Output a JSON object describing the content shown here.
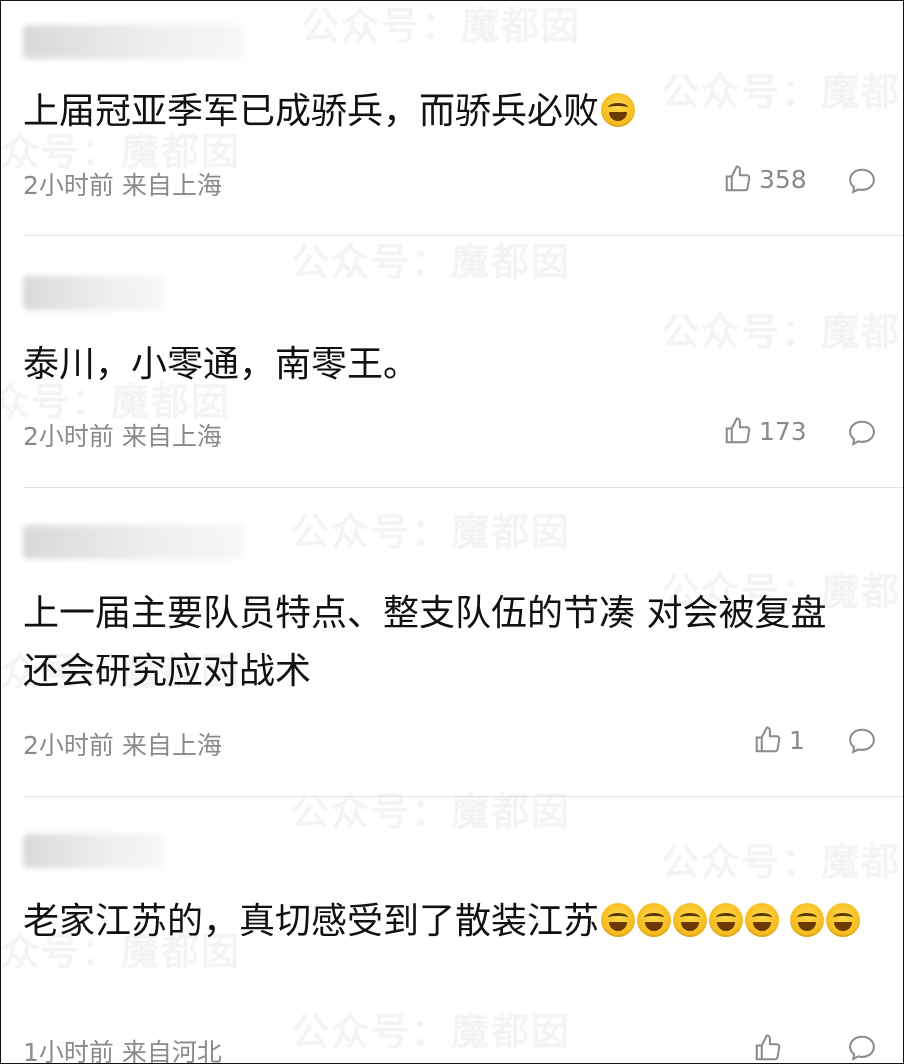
{
  "watermark": "公众号：魔都囡",
  "comments": [
    {
      "text": "上届冠亚季军已成骄兵，而骄兵必败",
      "emojis": [
        "laugh-cry-emoji"
      ],
      "meta": "2小时前 来自上海",
      "likes": "358"
    },
    {
      "text": "泰川，小零通，南零王。",
      "emojis": [],
      "meta": "2小时前 来自上海",
      "likes": "173"
    },
    {
      "text": "上一届主要队员特点、整支队伍的节凑 对会被复盘 还会研究应对战术",
      "emojis": [],
      "meta": "2小时前 来自上海",
      "likes": "1"
    },
    {
      "text": "老家江苏的，真切感受到了散装江苏",
      "emojis": [
        "laugh-cry-emoji",
        "laugh-cry-emoji",
        "laugh-cry-emoji",
        "laugh-cry-emoji",
        "laugh-emoji",
        "laugh-emoji",
        "laugh-emoji"
      ],
      "meta": "1小时前 来自河北",
      "likes": ""
    }
  ],
  "colors": {
    "text": "#111111",
    "meta": "#8a8a8a",
    "emoji": "#f5b91b"
  }
}
